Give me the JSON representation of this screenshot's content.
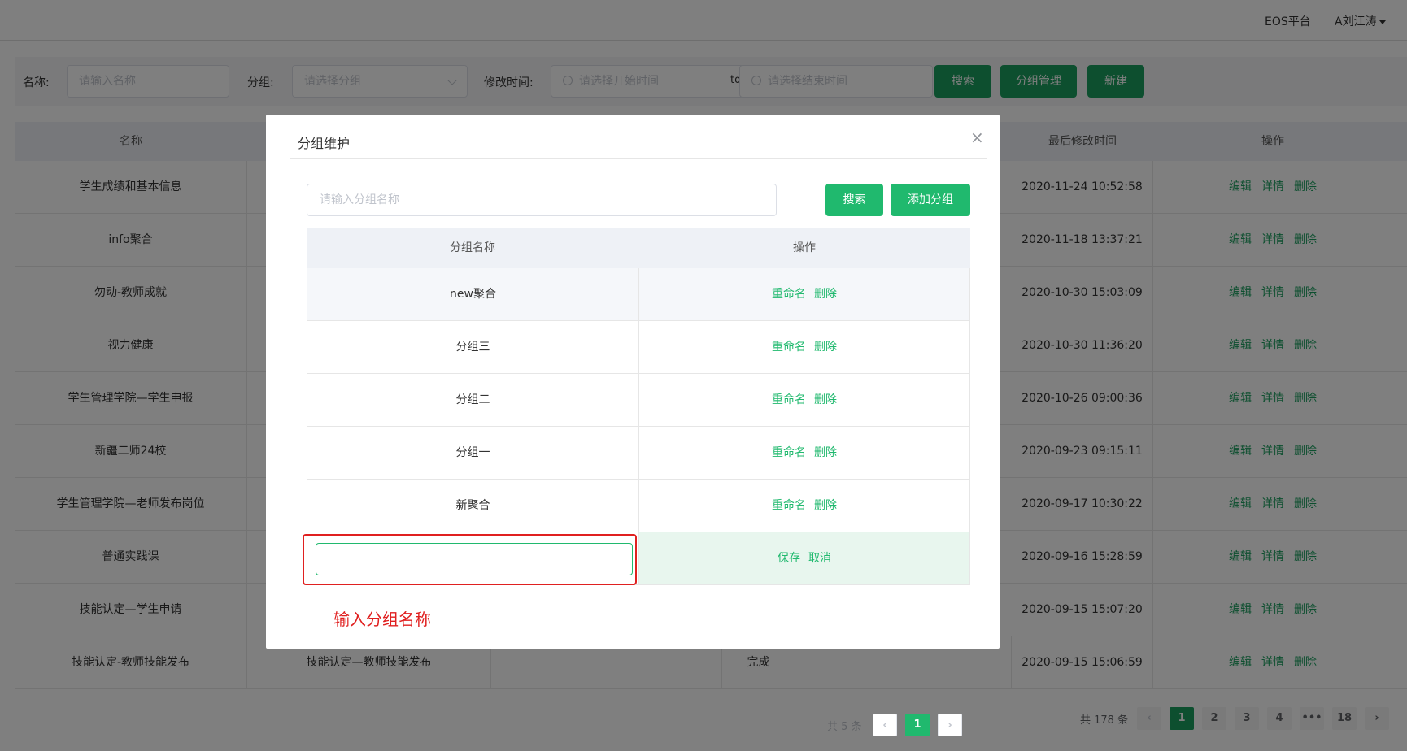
{
  "topbar": {
    "platform": "EOS平台",
    "user": "A刘江涛"
  },
  "filter": {
    "name_label": "名称:",
    "name_placeholder": "请输入名称",
    "group_label": "分组:",
    "group_placeholder": "请选择分组",
    "time_label": "修改时间:",
    "start_placeholder": "请选择开始时间",
    "to": "to",
    "end_placeholder": "请选择结束时间",
    "search_btn": "搜索",
    "group_mgmt_btn": "分组管理",
    "new_btn": "新建"
  },
  "table": {
    "headers": [
      "名称",
      "最后修改时间",
      "操作"
    ],
    "rows": [
      {
        "name": "学生成绩和基本信息",
        "time": "2020-11-24 10:52:58"
      },
      {
        "name": "info聚合",
        "time": "2020-11-18 13:37:21"
      },
      {
        "name": "勿动-教师成就",
        "time": "2020-10-30 15:03:09"
      },
      {
        "name": "视力健康",
        "time": "2020-10-30 11:36:20"
      },
      {
        "name": "学生管理学院—学生申报",
        "time": "2020-10-26 09:00:36"
      },
      {
        "name": "新疆二师24校",
        "time": "2020-09-23 09:15:11"
      },
      {
        "name": "学生管理学院—老师发布岗位",
        "time": "2020-09-17 10:30:22"
      },
      {
        "name": "普通实践课",
        "time": "2020-09-16 15:28:59"
      },
      {
        "name": "技能认定—学生申请",
        "time": "2020-09-15 15:07:20"
      },
      {
        "name": "技能认定-教师技能发布",
        "col2": "技能认定—教师技能发布",
        "status": "完成",
        "time": "2020-09-15 15:06:59"
      }
    ],
    "ops": {
      "edit": "编辑",
      "detail": "详情",
      "delete": "删除"
    }
  },
  "pagination": {
    "total": "共 178 条",
    "pages": [
      "1",
      "2",
      "3",
      "4",
      "•••",
      "18"
    ],
    "prev": "‹",
    "next": "›"
  },
  "modal": {
    "title": "分组维护",
    "close": "×",
    "search_placeholder": "请输入分组名称",
    "search_btn": "搜索",
    "add_btn": "添加分组",
    "headers": [
      "分组名称",
      "操作"
    ],
    "rows": [
      {
        "name": "new聚合"
      },
      {
        "name": "分组三"
      },
      {
        "name": "分组二"
      },
      {
        "name": "分组一"
      },
      {
        "name": "新聚合"
      }
    ],
    "rename": "重命名",
    "delete": "删除",
    "save": "保存",
    "cancel": "取消",
    "total": "共 5 条",
    "page": "1",
    "prev": "‹",
    "next": "›"
  },
  "annotation": {
    "label": "输入分组名称"
  }
}
